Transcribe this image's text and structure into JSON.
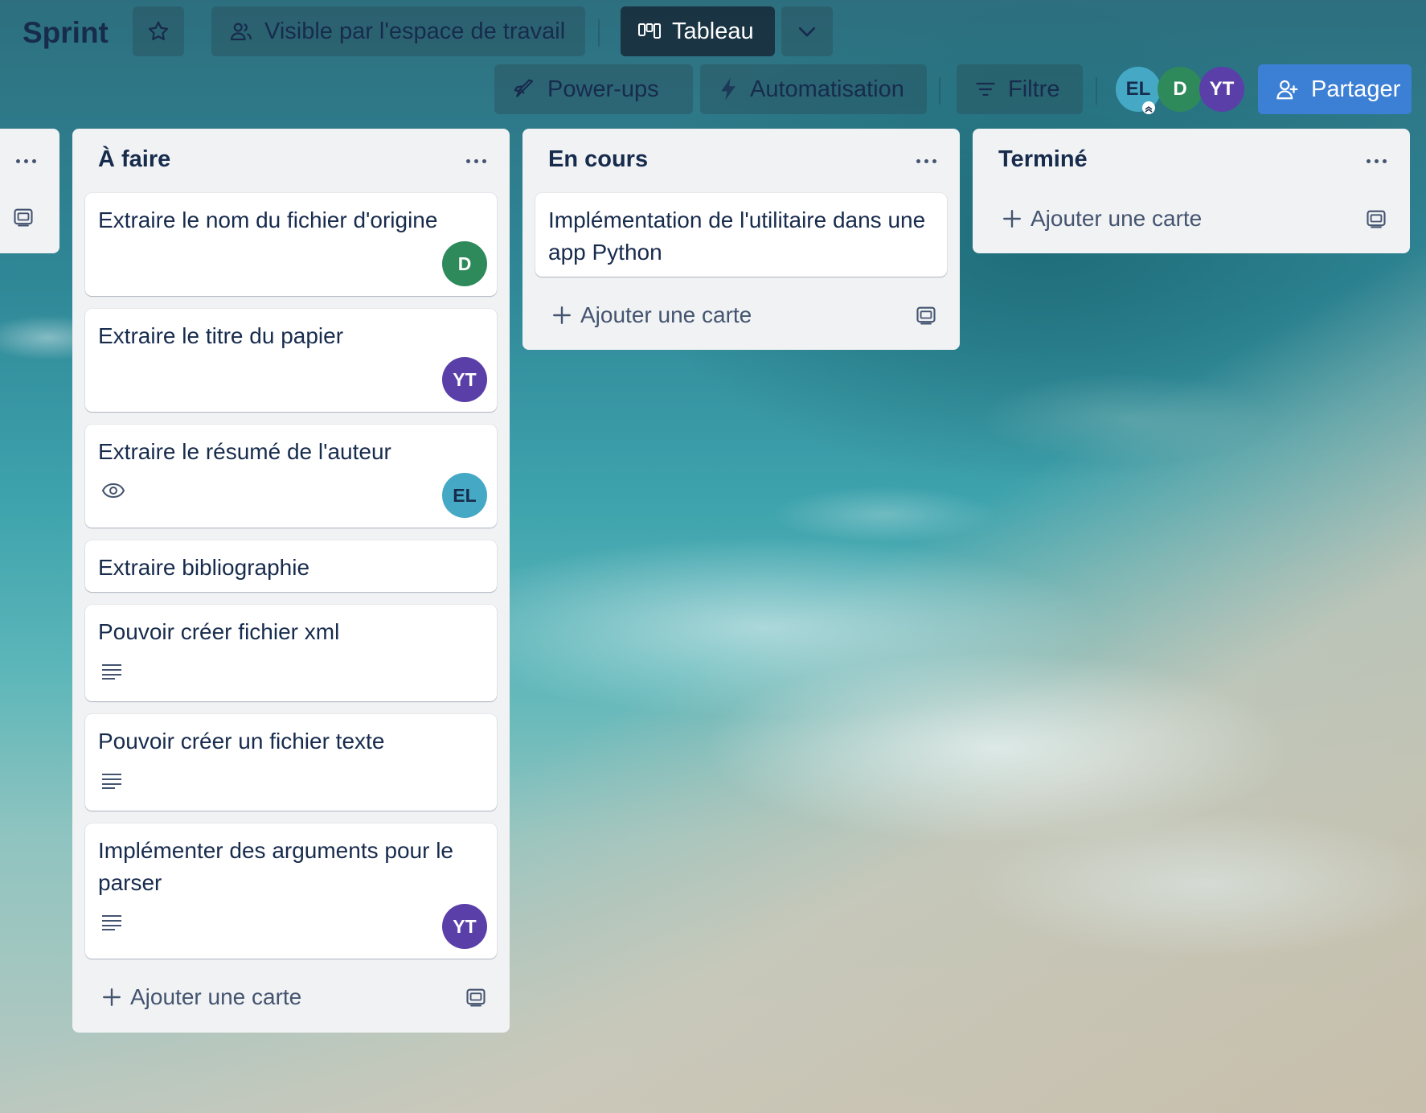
{
  "header": {
    "title": "Sprint",
    "visibility_label": "Visible par l'espace de travail",
    "view_label": "Tableau",
    "powerups_label": "Power-ups",
    "automation_label": "Automatisation",
    "filter_label": "Filtre",
    "share_label": "Partager",
    "members": [
      "EL",
      "D",
      "YT"
    ]
  },
  "lists": [
    {
      "title": "À faire",
      "cards": [
        {
          "title": "Extraire le nom du fichier d'origine",
          "avatar": "D"
        },
        {
          "title": "Extraire le titre du papier",
          "avatar": "YT"
        },
        {
          "title": "Extraire le résumé de l'auteur",
          "avatar": "EL",
          "icon": "eye-icon"
        },
        {
          "title": "Extraire bibliographie"
        },
        {
          "title": "Pouvoir créer fichier xml",
          "icon": "description-icon"
        },
        {
          "title": "Pouvoir créer un fichier texte",
          "icon": "description-icon"
        },
        {
          "title": "Implémenter des arguments pour le parser",
          "avatar": "YT",
          "icon": "description-icon"
        }
      ],
      "add_label": "Ajouter une carte"
    },
    {
      "title": "En cours",
      "cards": [
        {
          "title": "Implémentation de l'utilitaire dans une app Python"
        }
      ],
      "add_label": "Ajouter une carte"
    },
    {
      "title": "Terminé",
      "cards": [],
      "add_label": "Ajouter une carte"
    }
  ],
  "colors": {
    "avatar_el": "#45a9c5",
    "avatar_d": "#2f8a5b",
    "avatar_yt": "#5a3fa8",
    "share_button": "#3c80d5",
    "view_button": "#1e2e3e"
  }
}
